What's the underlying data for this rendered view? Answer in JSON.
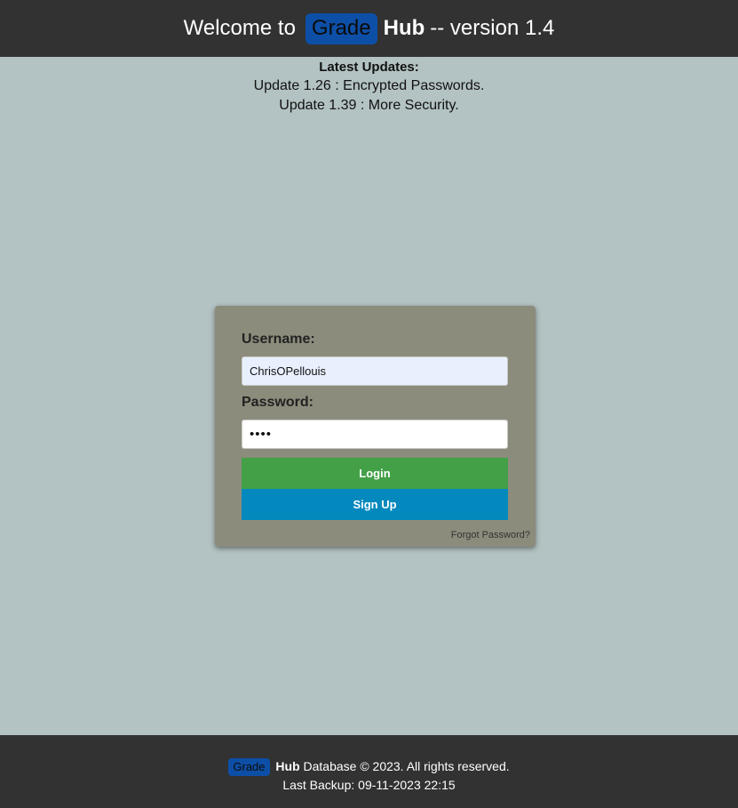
{
  "header": {
    "welcome_text": "Welcome to",
    "brand_grade": "Grade",
    "brand_hub": "Hub",
    "version_text": "-- version 1.4"
  },
  "updates": {
    "title": "Latest Updates:",
    "items": [
      "Update 1.26 : Encrypted Passwords.",
      "Update 1.39 : More Security."
    ]
  },
  "login": {
    "username_label": "Username:",
    "username_value": "ChrisOPellouis",
    "password_label": "Password:",
    "password_value": "••••",
    "login_button": "Login",
    "signup_button": "Sign Up",
    "forgot_link": "Forgot Password?"
  },
  "footer": {
    "brand_grade": "Grade",
    "brand_hub": "Hub",
    "copyright": "Database © 2023. All rights reserved.",
    "last_backup": "Last Backup: 09-11-2023 22:15"
  },
  "colors": {
    "header_bg": "#323232",
    "page_bg": "#b3c2c2",
    "card_bg": "#8c8c7c",
    "brand_badge": "#0d4fa6",
    "login_button": "#43a047",
    "signup_button": "#0389bd"
  }
}
